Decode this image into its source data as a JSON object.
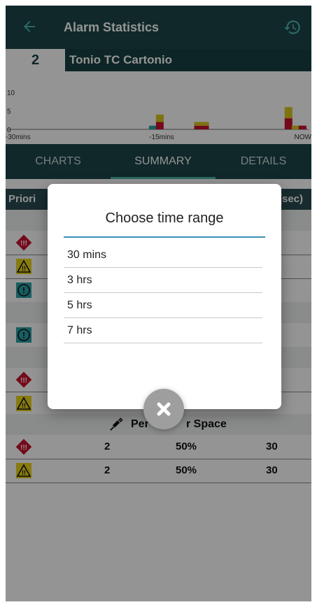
{
  "header": {
    "title": "Alarm Statistics",
    "back_icon": "arrow-left-icon",
    "history_icon": "history-icon"
  },
  "patient": {
    "bed": "2",
    "name": "Tonio TC Cartonio"
  },
  "chart_data": {
    "type": "bar",
    "stacked": true,
    "y_ticks": [
      "10",
      "5",
      "0"
    ],
    "x_ticks": [
      "-30mins",
      "-15mins",
      "NOW"
    ],
    "ylim": [
      0,
      10
    ],
    "colors": {
      "red": "#c8102e",
      "yellow": "#d9c61c",
      "teal": "#2aa0a6"
    },
    "bars": [
      {
        "t": -15.5,
        "stack": [
          {
            "color": "teal",
            "value": 1
          }
        ]
      },
      {
        "t": -14.8,
        "stack": [
          {
            "color": "red",
            "value": 2
          },
          {
            "color": "yellow",
            "value": 2
          }
        ]
      },
      {
        "t": -11.0,
        "stack": [
          {
            "color": "red",
            "value": 1
          },
          {
            "color": "yellow",
            "value": 1
          }
        ]
      },
      {
        "t": -10.3,
        "stack": [
          {
            "color": "red",
            "value": 1
          },
          {
            "color": "yellow",
            "value": 1
          }
        ]
      },
      {
        "t": -2.0,
        "stack": [
          {
            "color": "red",
            "value": 3
          },
          {
            "color": "yellow",
            "value": 3
          }
        ]
      },
      {
        "t": -1.3,
        "stack": [
          {
            "color": "yellow",
            "value": 1
          }
        ]
      },
      {
        "t": -0.6,
        "stack": [
          {
            "color": "red",
            "value": 1
          }
        ]
      }
    ]
  },
  "tabs": [
    {
      "label": "CHARTS"
    },
    {
      "label": "SUMMARY"
    },
    {
      "label": "DETAILS"
    }
  ],
  "table": {
    "header_left": "Priori",
    "header_right": "(sec)",
    "section_label": "Per",
    "section_label_end": "r Space",
    "rows": [
      {
        "count": "2",
        "percent": "50%",
        "duration": "30"
      },
      {
        "count": "2",
        "percent": "50%",
        "duration": "30"
      }
    ]
  },
  "dialog": {
    "title": "Choose time range",
    "options": [
      {
        "label": "30 mins"
      },
      {
        "label": "3 hrs"
      },
      {
        "label": "5 hrs"
      },
      {
        "label": "7 hrs"
      }
    ]
  }
}
